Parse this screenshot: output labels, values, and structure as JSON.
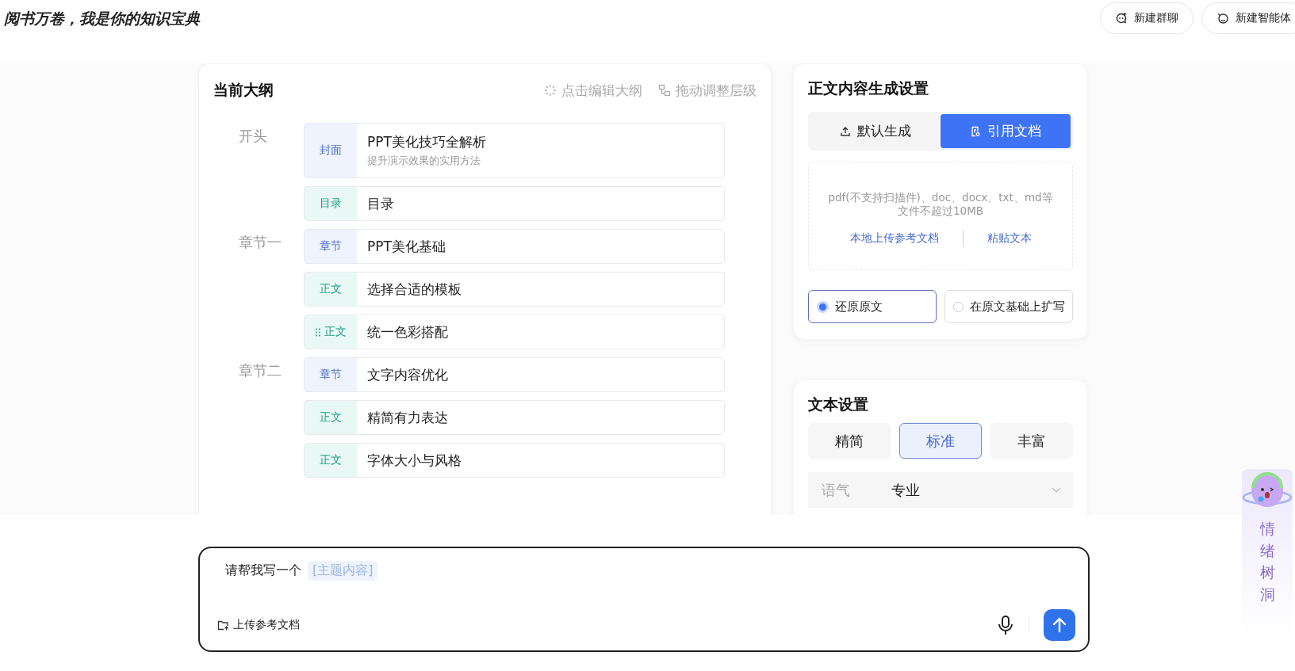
{
  "header": {
    "title": "阅书万卷，我是你的知识宝典",
    "buttons": [
      {
        "label": "新建群聊",
        "kind": "group"
      },
      {
        "label": "新建智能体",
        "kind": "agent"
      }
    ]
  },
  "outline": {
    "title": "当前大纲",
    "actions": [
      {
        "label": "点击编辑大纲",
        "kind": "edit"
      },
      {
        "label": "拖动调整层级",
        "kind": "drag"
      }
    ],
    "sections": [
      {
        "label": "开头",
        "items": [
          {
            "tag": "封面",
            "kind": "cover",
            "title": "PPT美化技巧全解析",
            "subtitle": "提升演示效果的实用方法",
            "drag_handle": false
          },
          {
            "tag": "目录",
            "kind": "toc",
            "title": "目录",
            "drag_handle": false
          }
        ]
      },
      {
        "label": "章节一",
        "items": [
          {
            "tag": "章节",
            "kind": "chapter",
            "title": "PPT美化基础",
            "drag_handle": false
          },
          {
            "tag": "正文",
            "kind": "body",
            "title": "选择合适的模板",
            "drag_handle": false
          },
          {
            "tag": "正文",
            "kind": "body",
            "title": "统一色彩搭配",
            "drag_handle": true
          }
        ]
      },
      {
        "label": "章节二",
        "items": [
          {
            "tag": "章节",
            "kind": "chapter",
            "title": "文字内容优化",
            "drag_handle": false
          },
          {
            "tag": "正文",
            "kind": "body",
            "title": "精简有力表达",
            "drag_handle": false
          },
          {
            "tag": "正文",
            "kind": "body",
            "title": "字体大小与风格",
            "drag_handle": false
          }
        ]
      }
    ]
  },
  "content_settings": {
    "title": "正文内容生成设置",
    "modes": [
      {
        "label": "默认生成",
        "kind": "upload",
        "selected": false
      },
      {
        "label": "引用文档",
        "kind": "document",
        "selected": true
      }
    ],
    "upload": {
      "hint": [
        "pdf(不支持扫描件)、doc、docx、txt、md等",
        "文件不超过10MB"
      ],
      "links": [
        "本地上传参考文档",
        "粘贴文本"
      ]
    },
    "options": [
      {
        "label": "还原原文",
        "selected": true
      },
      {
        "label": "在原文基础上扩写",
        "selected": false
      }
    ]
  },
  "text_settings": {
    "title": "文本设置",
    "lengths": [
      {
        "label": "精简",
        "selected": false
      },
      {
        "label": "标准",
        "selected": true
      },
      {
        "label": "丰富",
        "selected": false
      }
    ],
    "tone": {
      "label": "语气",
      "value": "专业"
    }
  },
  "composer": {
    "prompt": "请帮我写一个",
    "slot": "[主题内容]",
    "upload_label": "上传参考文档"
  },
  "side_widget": {
    "label": "情绪树洞"
  }
}
